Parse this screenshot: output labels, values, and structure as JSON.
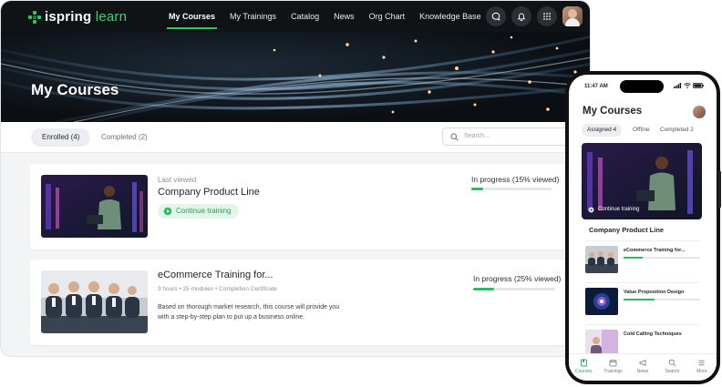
{
  "header": {
    "logo_brand": "ispring",
    "logo_product": "learn",
    "nav": [
      "My Courses",
      "My Trainings",
      "Catalog",
      "News",
      "Org Chart",
      "Knowledge Base"
    ],
    "active_nav": "My Courses"
  },
  "hero": {
    "title": "My Courses"
  },
  "tabs": {
    "enrolled": "Enrolled (4)",
    "completed": "Completed (2)"
  },
  "search": {
    "placeholder": "Search..."
  },
  "courses": [
    {
      "last_viewed": "Last viewed",
      "title": "Company Product Line",
      "action": "Continue training",
      "progress_label": "In progress (15% viewed)",
      "progress": 15
    },
    {
      "title": "eCommerce Training for...",
      "meta": "3 hours • 25 modules • Completion Certificate",
      "description": "Based on thorough market research, this course will provide you with a step-by-step plan to put up a business online.",
      "progress_label": "In progress (25% viewed)",
      "progress": 25
    }
  ],
  "phone": {
    "time": "11:47 AM",
    "title": "My Courses",
    "tabs": [
      "Assigned 4",
      "Offline",
      "Completed 2"
    ],
    "hero_action": "Continue training",
    "hero_title": "Company Product Line",
    "rows": [
      {
        "title": "eCommerce Training for...",
        "progress": 25
      },
      {
        "title": "Value Proposition Design",
        "progress": 40
      },
      {
        "title": "Cold Calling Techniques",
        "progress": 0
      }
    ],
    "bottom_nav": [
      "Courses",
      "Trainings",
      "News",
      "Search",
      "More"
    ]
  },
  "colors": {
    "accent": "#2fb866",
    "topbar": "#0f1316"
  }
}
